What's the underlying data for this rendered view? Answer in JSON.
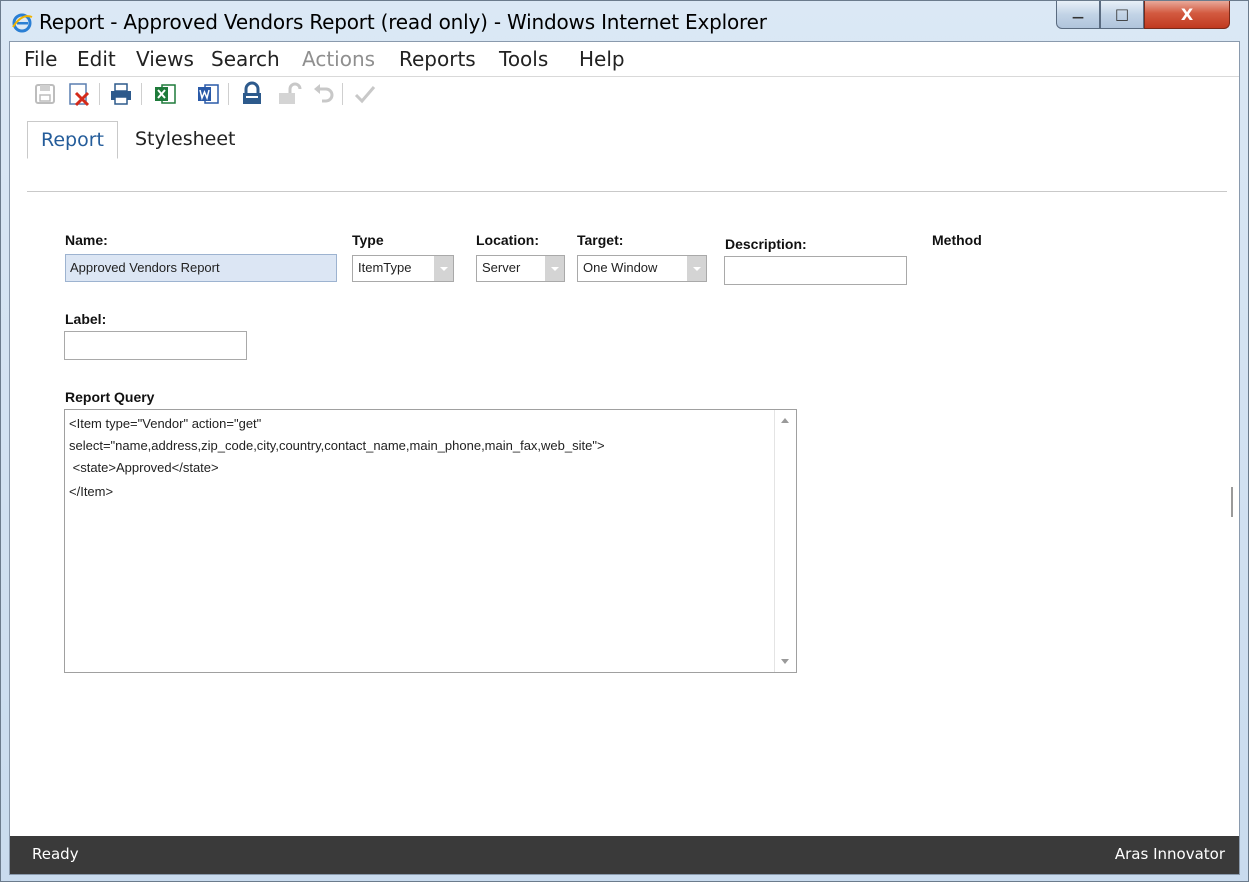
{
  "window": {
    "title": "Report - Approved Vendors Report (read only) - Windows Internet Explorer",
    "controls": {
      "minimize": "—",
      "maximize": "□",
      "close": "X"
    }
  },
  "menu": [
    "File",
    "Edit",
    "Views",
    "Search",
    "Actions",
    "Reports",
    "Tools",
    "Help"
  ],
  "menu_disabled": [
    "Actions"
  ],
  "toolbar": [
    "save-icon",
    "close-delete-icon",
    "print-icon",
    "excel-icon",
    "word-icon",
    "lock-icon",
    "unlock-icon",
    "undo-icon",
    "done-checkmark-icon"
  ],
  "tabs": {
    "active": "Report",
    "inactive": "Stylesheet"
  },
  "form": {
    "name_label": "Name:",
    "name_value": "Approved Vendors Report",
    "type_label": "Type",
    "type_value": "ItemType",
    "location_label": "Location:",
    "location_value": "Server",
    "target_label": "Target:",
    "target_value": "One Window",
    "description_label": "Description:",
    "description_value": "",
    "method_label": "Method",
    "label_label": "Label:",
    "label_value": "",
    "query_label": "Report Query",
    "query_lines": [
      "<Item type=\"Vendor\" action=\"get\"",
      "select=\"name,address,zip_code,city,country,contact_name,main_phone,main_fax,web_site\">",
      " <state>Approved</state>",
      "</Item>"
    ]
  },
  "status": {
    "left": "Ready",
    "right": "Aras Innovator"
  },
  "colors": {
    "accent_tab": "#245c9a",
    "name_field_bg": "#dce6f4",
    "status_bg": "#3a3a3a"
  }
}
